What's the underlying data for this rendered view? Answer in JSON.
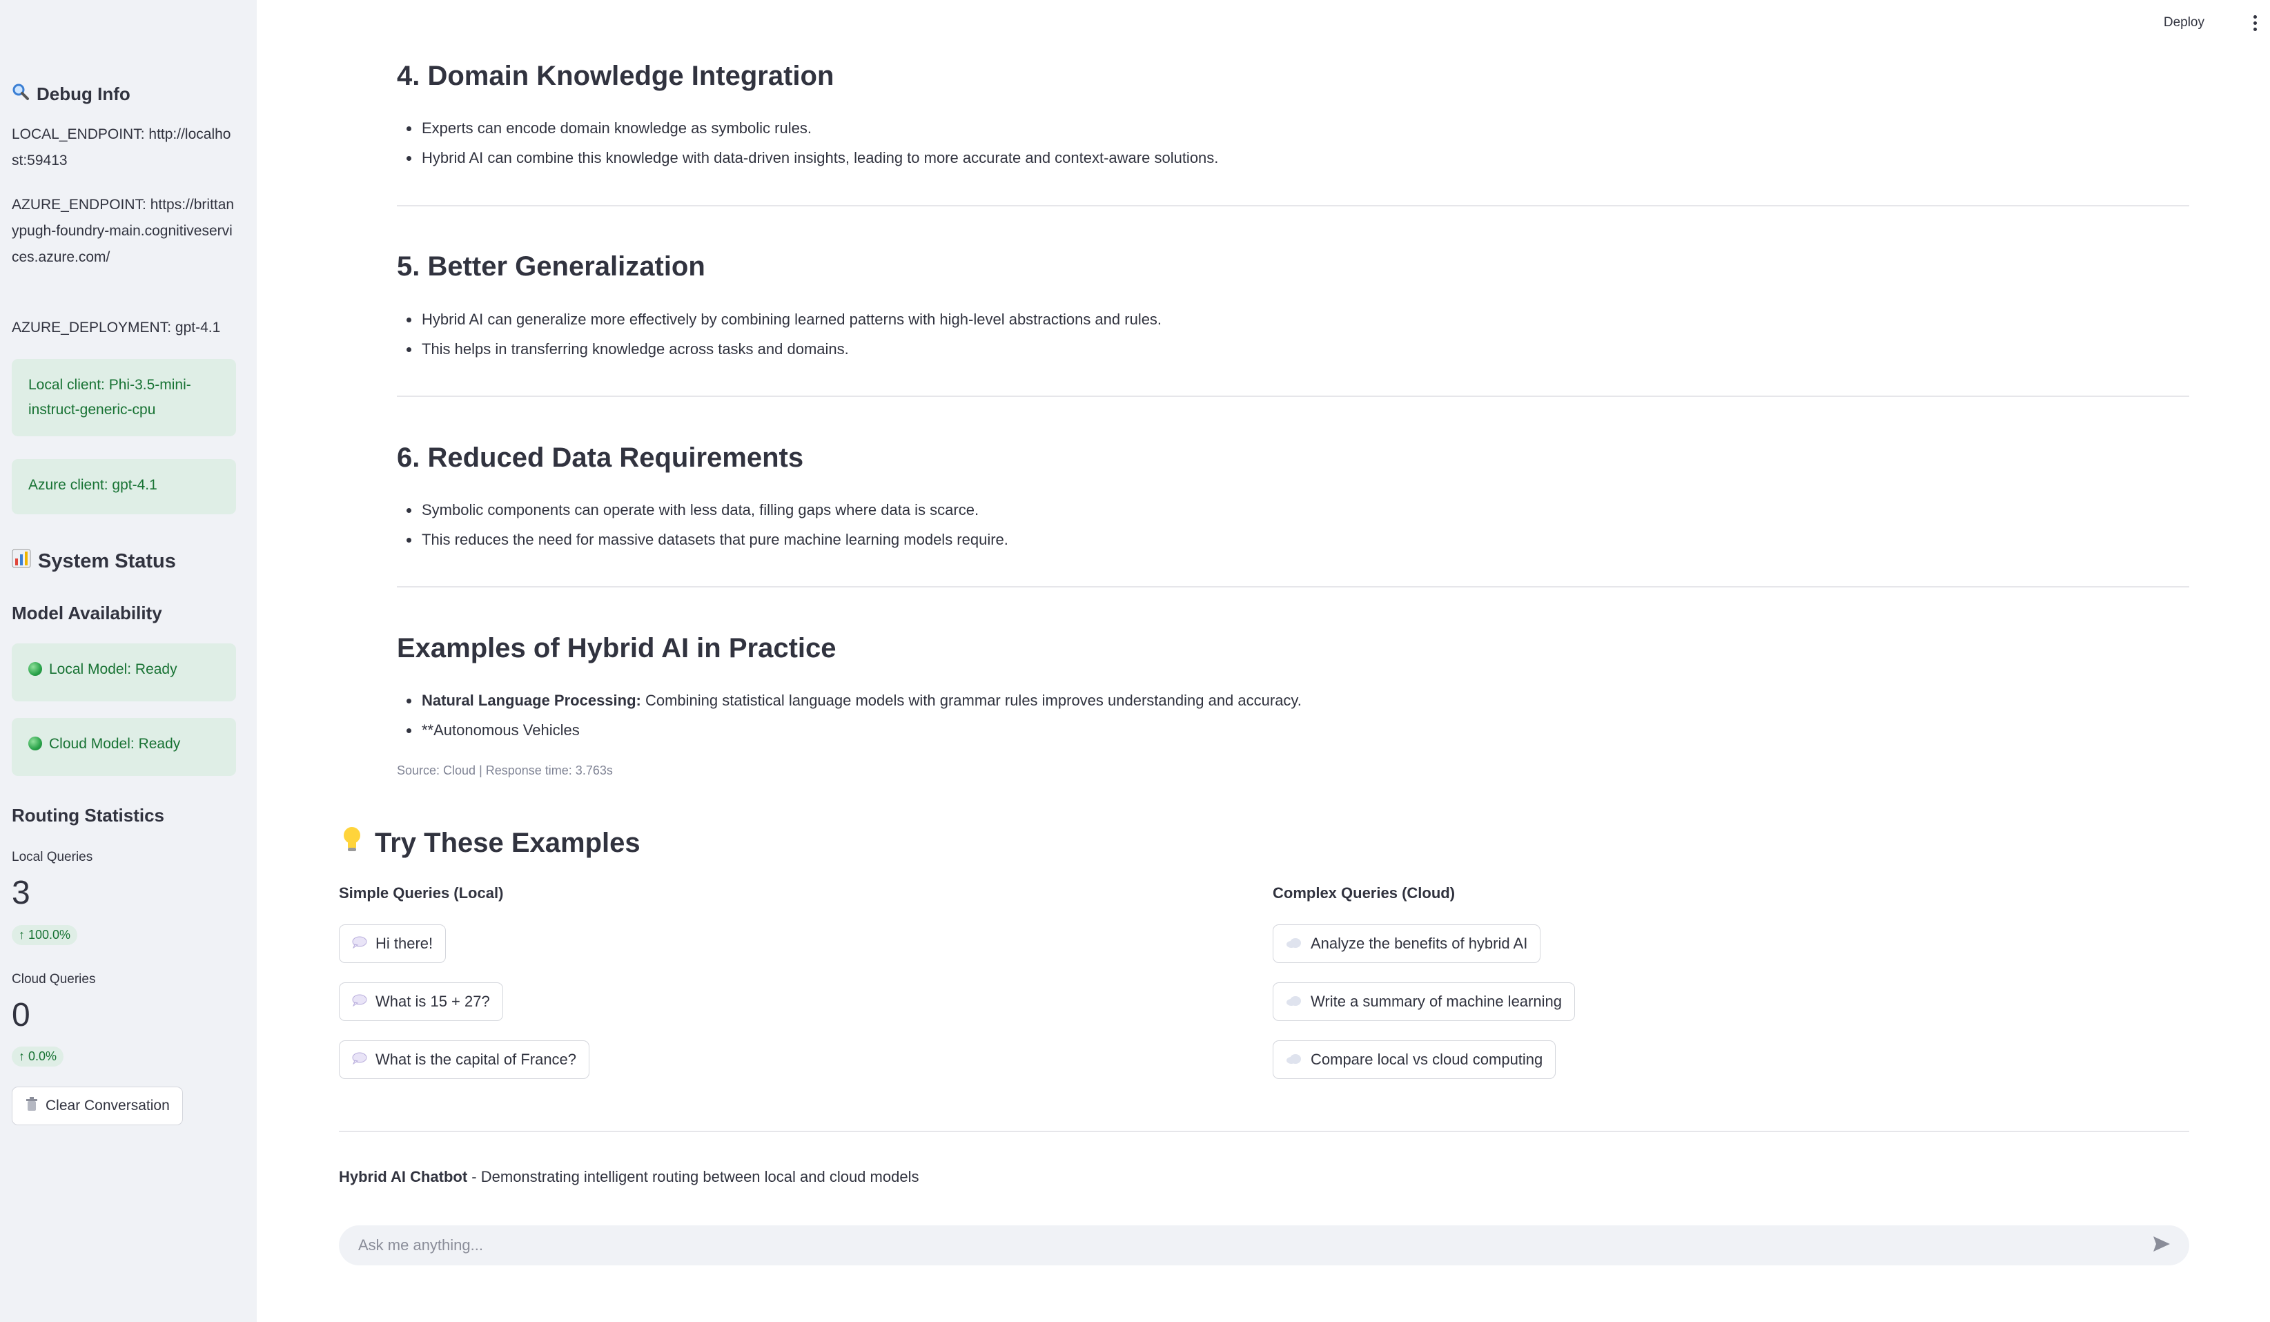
{
  "topbar": {
    "deploy_label": "Deploy"
  },
  "sidebar": {
    "debug_title": "Debug Info",
    "local_endpoint": "LOCAL_ENDPOINT: http://localhost:59413",
    "azure_endpoint": "AZURE_ENDPOINT: https://brittanypugh-foundry-main.cognitiveservices.azure.com/",
    "azure_deployment": "AZURE_DEPLOYMENT: gpt-4.1",
    "local_client": "Local client: Phi-3.5-mini-instruct-generic-cpu",
    "azure_client": "Azure client: gpt-4.1",
    "status_title": "System Status",
    "availability_title": "Model Availability",
    "local_model": "Local Model: Ready",
    "cloud_model": "Cloud Model: Ready",
    "routing_title": "Routing Statistics",
    "local_queries_label": "Local Queries",
    "local_queries_value": "3",
    "local_queries_delta": "100.0%",
    "cloud_queries_label": "Cloud Queries",
    "cloud_queries_value": "0",
    "cloud_queries_delta": "0.0%",
    "clear_button": "Clear Conversation"
  },
  "main": {
    "s4_title": "4. Domain Knowledge Integration",
    "s4_b1": "Experts can encode domain knowledge as symbolic rules.",
    "s4_b2": "Hybrid AI can combine this knowledge with data-driven insights, leading to more accurate and context-aware solutions.",
    "s5_title": "5. Better Generalization",
    "s5_b1": "Hybrid AI can generalize more effectively by combining learned patterns with high-level abstractions and rules.",
    "s5_b2": "This helps in transferring knowledge across tasks and domains.",
    "s6_title": "6. Reduced Data Requirements",
    "s6_b1": "Symbolic components can operate with less data, filling gaps where data is scarce.",
    "s6_b2": "This reduces the need for massive datasets that pure machine learning models require.",
    "ex_title": "Examples of Hybrid AI in Practice",
    "ex_b1_bold": "Natural Language Processing:",
    "ex_b1_rest": " Combining statistical language models with grammar rules improves understanding and accuracy.",
    "ex_b2": "**Autonomous Vehicles",
    "caption": "Source: Cloud | Response time: 3.763s"
  },
  "examples": {
    "title": "Try These Examples",
    "simple_title": "Simple Queries (Local)",
    "simple": [
      "Hi there!",
      "What is 15 + 27?",
      "What is the capital of France?"
    ],
    "complex_title": "Complex Queries (Cloud)",
    "complex": [
      "Analyze the benefits of hybrid AI",
      "Write a summary of machine learning",
      "Compare local vs cloud computing"
    ]
  },
  "footer": {
    "bold": "Hybrid AI Chatbot",
    "rest": " - Demonstrating intelligent routing between local and cloud models"
  },
  "chat": {
    "placeholder": "Ask me anything..."
  }
}
